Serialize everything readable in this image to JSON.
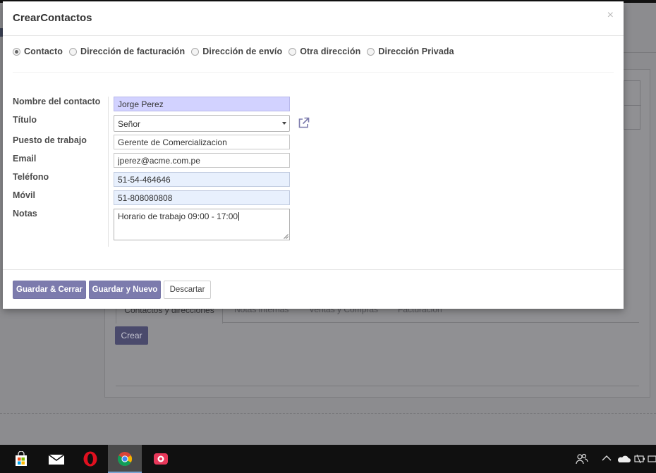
{
  "modal": {
    "title": "CrearContactos",
    "close_glyph": "×",
    "address_types": [
      {
        "label": "Contacto",
        "checked": true
      },
      {
        "label": "Dirección de facturación",
        "checked": false
      },
      {
        "label": "Dirección de envío",
        "checked": false
      },
      {
        "label": "Otra dirección",
        "checked": false
      },
      {
        "label": "Dirección Privada",
        "checked": false
      }
    ],
    "labels": {
      "name": "Nombre del contacto",
      "title": "Título",
      "job": "Puesto de trabajo",
      "email": "Email",
      "phone": "Teléfono",
      "mobile": "Móvil",
      "notes": "Notas"
    },
    "values": {
      "name": "Jorge Perez",
      "title": "Señor",
      "job": "Gerente de Comercializacion",
      "email": "jperez@acme.com.pe",
      "phone": "51-54-464646",
      "mobile": "51-808080808",
      "notes": "Horario de trabajo 09:00 - 17:00"
    },
    "buttons": {
      "save_close": "Guardar & Cerrar",
      "save_new": "Guardar y Nuevo",
      "discard": "Descartar"
    }
  },
  "background": {
    "tabs": [
      "Contactos y direcciones",
      "Notas internas",
      "Ventas y Compras",
      "Facturación"
    ],
    "create_button": "Crear"
  },
  "colors": {
    "primary": "#7c7bad",
    "required_field": "#d2d2ff",
    "autofill_field": "#e8f0fd",
    "backdrop": "#8c8c8f",
    "taskbar": "#101010"
  },
  "taskbar": {
    "apps": [
      "store-icon",
      "mail-icon",
      "opera-icon",
      "chrome-icon",
      "camera-icon"
    ],
    "tray": [
      "people-icon",
      "chevron-up-icon",
      "onedrive-icon",
      "battery-icon",
      "network-icon"
    ]
  }
}
